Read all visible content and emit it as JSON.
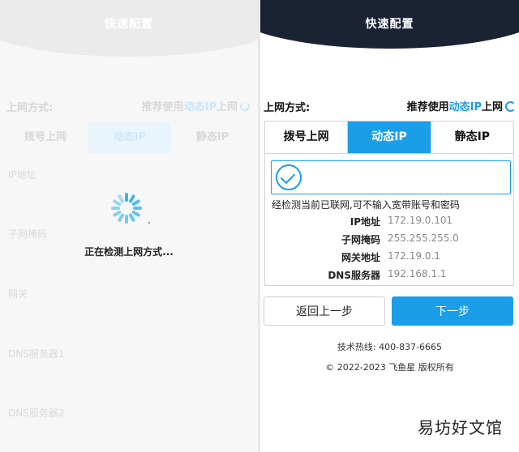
{
  "left": {
    "title": "快速配置",
    "mode_label": "上网方式:",
    "recommend_prefix": "推荐使用",
    "recommend_accent": "动态IP",
    "recommend_suffix": "上网",
    "tabs": [
      "拨号上网",
      "动态IP",
      "静态IP"
    ],
    "fields": [
      "IP地址",
      "子网掩码",
      "网关",
      "DNS服务器1",
      "DNS服务器2"
    ],
    "loading_text": "正在检测上网方式..."
  },
  "right": {
    "title": "快速配置",
    "mode_label": "上网方式:",
    "recommend_prefix": "推荐使用",
    "recommend_accent": "动态IP",
    "recommend_suffix": "上网",
    "tabs": [
      {
        "label": "拨号上网",
        "active": false
      },
      {
        "label": "动态IP",
        "active": true
      },
      {
        "label": "静态IP",
        "active": false
      }
    ],
    "notice": "经检测当前已联网,可不输入宽带账号和密码",
    "rows": [
      {
        "label": "IP地址",
        "value": "172.19.0.101"
      },
      {
        "label": "子网掩码",
        "value": "255.255.255.0"
      },
      {
        "label": "网关地址",
        "value": "172.19.0.1"
      },
      {
        "label": "DNS服务器",
        "value": "192.168.1.1"
      }
    ],
    "back_button": "返回上一步",
    "next_button": "下一步",
    "hotline": "技术热线: 400-837-6665",
    "copyright": "© 2022-2023 飞鱼星 版权所有"
  },
  "watermark": "易坊好文馆",
  "colors": {
    "accent": "#1a9ee8",
    "header_dark": "#1a2233"
  }
}
